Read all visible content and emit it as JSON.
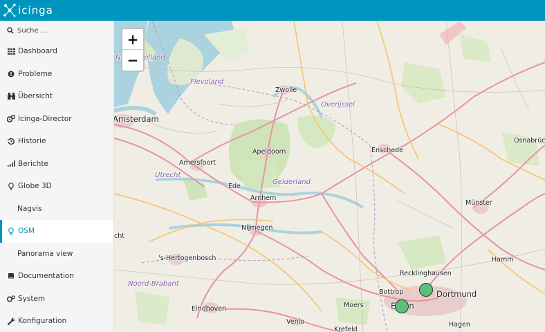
{
  "app": {
    "brand": "icinga",
    "header_color": "#0095bf"
  },
  "search": {
    "placeholder": "Suche ..."
  },
  "nav": [
    {
      "label": "Dashboard",
      "icon": "grid-icon"
    },
    {
      "label": "Probleme",
      "icon": "alert-icon"
    },
    {
      "label": "Übersicht",
      "icon": "binoculars-icon"
    },
    {
      "label": "Icinga-Director",
      "icon": "cogs-icon"
    },
    {
      "label": "Historie",
      "icon": "history-icon"
    },
    {
      "label": "Berichte",
      "icon": "bar-chart-icon"
    },
    {
      "label": "Globe 3D",
      "icon": "bulb-icon"
    },
    {
      "label": "Nagvis",
      "icon": ""
    },
    {
      "label": "OSM",
      "icon": "bulb-icon",
      "active": true
    },
    {
      "label": "Panorama view",
      "icon": ""
    },
    {
      "label": "Documentation",
      "icon": "book-icon"
    },
    {
      "label": "System",
      "icon": "settings-icon"
    },
    {
      "label": "Konfiguration",
      "icon": "wrench-icon"
    }
  ],
  "map": {
    "zoom_in": "+",
    "zoom_out": "−",
    "cities": {
      "amsterdam": "Amsterdam",
      "zwolle": "Zwolle",
      "apeldoorn": "Apeldoorn",
      "amersfoort": "Amersfoort",
      "ede": "Ede",
      "arnhem": "Arnhem",
      "nijmegen": "Nijmegen",
      "enschede": "Enschede",
      "muenster": "Münster",
      "osnabrueck": "Osnabrück",
      "hertogenbosch": "'s-Hertogenbosch",
      "eindhoven": "Eindhoven",
      "venlo": "Venlo",
      "recklinghausen": "Recklinghausen",
      "dortmund": "Dortmund",
      "essen": "Essen",
      "bottrop": "Bottrop",
      "moers": "Moers",
      "hamm": "Hamm",
      "hagen": "Hagen",
      "krefeld": "Krefeld",
      "utrecht_cut": "cht"
    },
    "provinces": {
      "noord_holland": "Noord-Holland",
      "flevoland": "Flevoland",
      "overijssel": "Overijssel",
      "gelderland": "Gelderland",
      "utrecht": "Utrecht",
      "noord_brabant": "Noord-Brabant"
    },
    "markers": [
      {
        "name": "host-marker",
        "color": "#5cbf7c"
      },
      {
        "name": "host-marker",
        "color": "#5cbf7c"
      }
    ]
  }
}
